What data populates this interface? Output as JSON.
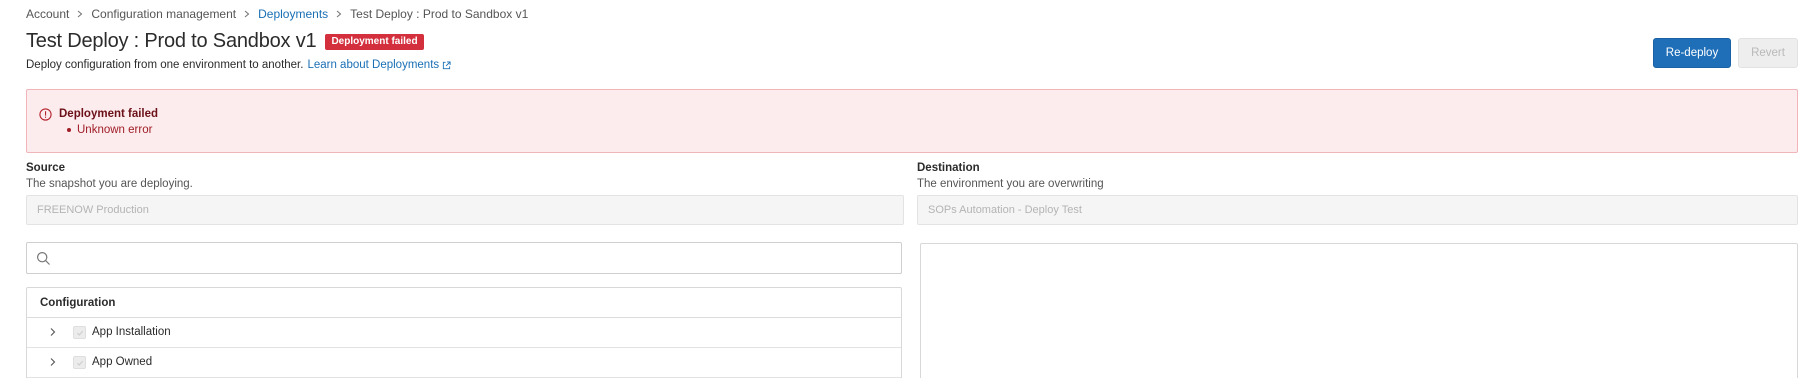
{
  "breadcrumb": {
    "items": [
      {
        "label": "Account",
        "link": false
      },
      {
        "label": "Configuration management",
        "link": false
      },
      {
        "label": "Deployments",
        "link": true
      },
      {
        "label": "Test Deploy : Prod to Sandbox v1",
        "link": false
      }
    ]
  },
  "header": {
    "title": "Test Deploy : Prod to Sandbox v1",
    "status_badge": "Deployment failed",
    "subtitle": "Deploy configuration from one environment to another.",
    "learn_link": "Learn about Deployments"
  },
  "actions": {
    "redeploy_label": "Re-deploy",
    "revert_label": "Revert"
  },
  "alert": {
    "title": "Deployment failed",
    "errors": [
      "Unknown error"
    ]
  },
  "source": {
    "label": "Source",
    "help": "The snapshot you are deploying.",
    "value": "FREENOW Production"
  },
  "destination": {
    "label": "Destination",
    "help": "The environment you are overwriting",
    "value": "SOPs Automation - Deploy Test"
  },
  "search": {
    "placeholder": ""
  },
  "tree": {
    "header": "Configuration",
    "items": [
      {
        "label": "App Installation"
      },
      {
        "label": "App Owned"
      }
    ]
  },
  "colors": {
    "primary": "#1f6fb8",
    "danger": "#d32f3c",
    "alert_bg": "#fdeced",
    "link": "#1a6fb5"
  }
}
